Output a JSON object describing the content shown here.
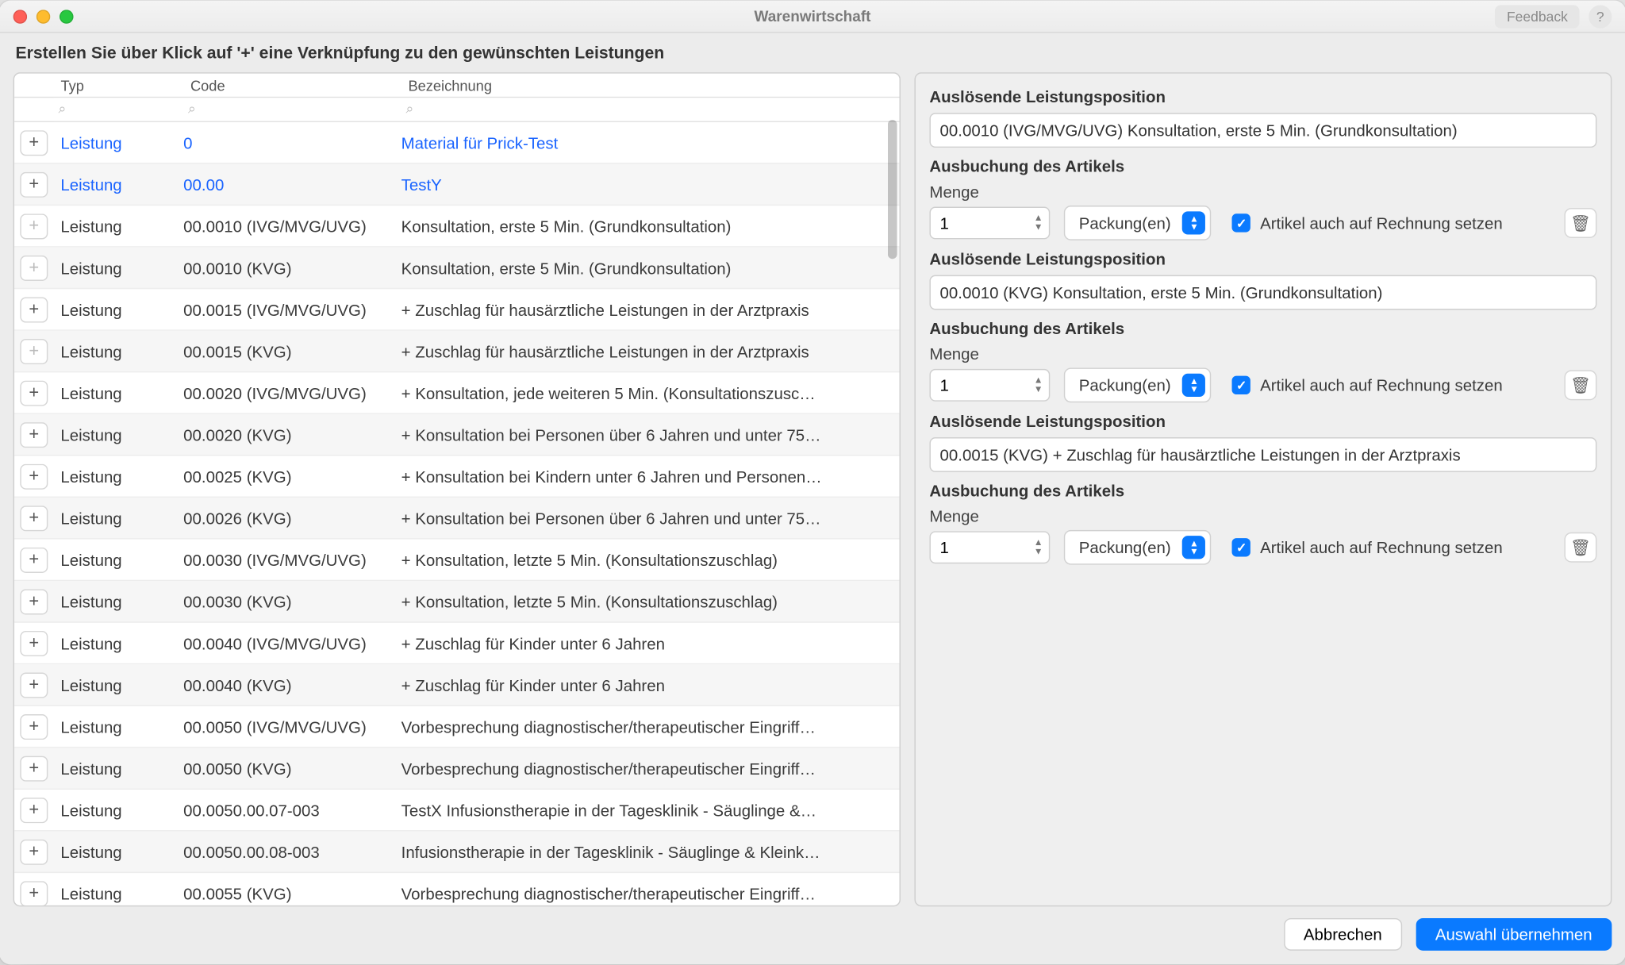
{
  "window": {
    "title": "Warenwirtschaft",
    "feedback": "Feedback",
    "help": "?"
  },
  "instruction": "Erstellen Sie über Klick auf '+' eine Verknüpfung zu den gewünschten Leistungen",
  "columns": {
    "typ": "Typ",
    "code": "Code",
    "bez": "Bezeichnung"
  },
  "rows": [
    {
      "typ": "Leistung",
      "code": "0",
      "bez": "Material für Prick-Test",
      "linked": true,
      "add": true
    },
    {
      "typ": "Leistung",
      "code": "00.00",
      "bez": "TestY",
      "linked": true,
      "add": true
    },
    {
      "typ": "Leistung",
      "code": "00.0010 (IVG/MVG/UVG)",
      "bez": "Konsultation, erste 5 Min. (Grundkonsultation)",
      "add": false
    },
    {
      "typ": "Leistung",
      "code": "00.0010 (KVG)",
      "bez": "Konsultation, erste 5 Min. (Grundkonsultation)",
      "add": false
    },
    {
      "typ": "Leistung",
      "code": "00.0015 (IVG/MVG/UVG)",
      "bez": "+ Zuschlag für hausärztliche Leistungen in der Arztpraxis",
      "add": true
    },
    {
      "typ": "Leistung",
      "code": "00.0015 (KVG)",
      "bez": "+ Zuschlag für hausärztliche Leistungen in der Arztpraxis",
      "add": false
    },
    {
      "typ": "Leistung",
      "code": "00.0020 (IVG/MVG/UVG)",
      "bez": "+ Konsultation, jede weiteren 5 Min. (Konsultationszusc…",
      "add": true
    },
    {
      "typ": "Leistung",
      "code": "00.0020 (KVG)",
      "bez": "+ Konsultation bei Personen über 6 Jahren und unter 75…",
      "add": true
    },
    {
      "typ": "Leistung",
      "code": "00.0025 (KVG)",
      "bez": "+ Konsultation bei Kindern unter 6 Jahren und Personen…",
      "add": true
    },
    {
      "typ": "Leistung",
      "code": "00.0026 (KVG)",
      "bez": "+ Konsultation bei Personen über 6 Jahren und unter 75…",
      "add": true
    },
    {
      "typ": "Leistung",
      "code": "00.0030 (IVG/MVG/UVG)",
      "bez": "+ Konsultation, letzte 5 Min. (Konsultationszuschlag)",
      "add": true
    },
    {
      "typ": "Leistung",
      "code": "00.0030 (KVG)",
      "bez": "+ Konsultation, letzte 5 Min. (Konsultationszuschlag)",
      "add": true
    },
    {
      "typ": "Leistung",
      "code": "00.0040 (IVG/MVG/UVG)",
      "bez": "+ Zuschlag für Kinder unter 6 Jahren",
      "add": true
    },
    {
      "typ": "Leistung",
      "code": "00.0040 (KVG)",
      "bez": "+ Zuschlag für Kinder unter 6 Jahren",
      "add": true
    },
    {
      "typ": "Leistung",
      "code": "00.0050 (IVG/MVG/UVG)",
      "bez": "Vorbesprechung diagnostischer/therapeutischer Eingriff…",
      "add": true
    },
    {
      "typ": "Leistung",
      "code": "00.0050 (KVG)",
      "bez": "Vorbesprechung diagnostischer/therapeutischer Eingriff…",
      "add": true
    },
    {
      "typ": "Leistung",
      "code": "00.0050.00.07-003",
      "bez": "TestX Infusionstherapie in der Tagesklinik - Säuglinge &…",
      "add": true
    },
    {
      "typ": "Leistung",
      "code": "00.0050.00.08-003",
      "bez": "Infusionstherapie in der Tagesklinik - Säuglinge & Kleink…",
      "add": true
    },
    {
      "typ": "Leistung",
      "code": "00.0055 (KVG)",
      "bez": "Vorbesprechung diagnostischer/therapeutischer Eingriff…",
      "add": true
    }
  ],
  "detail": {
    "trigger_label": "Auslösende Leistungsposition",
    "booking_label": "Ausbuchung des Artikels",
    "menge_label": "Menge",
    "unit": "Packung(en)",
    "invoice_label": "Artikel auch auf Rechnung setzen",
    "items": [
      {
        "position": "00.0010 (IVG/MVG/UVG) Konsultation, erste 5 Min. (Grundkonsultation)",
        "menge": "1"
      },
      {
        "position": "00.0010 (KVG) Konsultation, erste 5 Min. (Grundkonsultation)",
        "menge": "1"
      },
      {
        "position": "00.0015 (KVG) + Zuschlag für hausärztliche Leistungen in der Arztpraxis",
        "menge": "1"
      }
    ]
  },
  "footer": {
    "cancel": "Abbrechen",
    "apply": "Auswahl übernehmen"
  }
}
